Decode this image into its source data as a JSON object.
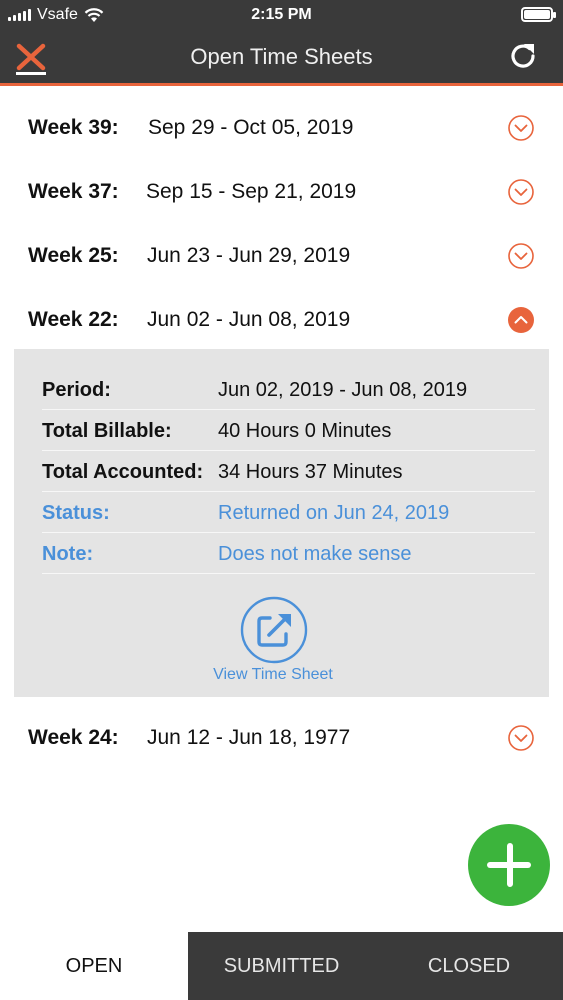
{
  "status_bar": {
    "carrier": "Vsafe",
    "time": "2:15 PM"
  },
  "header": {
    "title": "Open Time Sheets",
    "logo_icon": "x-logo-icon",
    "refresh_icon": "refresh-icon"
  },
  "colors": {
    "accent": "#e8643c",
    "header_bg": "#3a3a3a",
    "link_blue": "#4a90d9",
    "fab_green": "#3cb43c",
    "detail_bg": "#e4e4e4"
  },
  "weeks": [
    {
      "label": "Week 39:",
      "range": "Sep 29 - Oct 05, 2019",
      "expanded": false
    },
    {
      "label": "Week 37:",
      "range": "Sep 15 - Sep 21, 2019",
      "expanded": false
    },
    {
      "label": "Week 25:",
      "range": "Jun 23 - Jun 29, 2019",
      "expanded": false
    },
    {
      "label": "Week 22:",
      "range": "Jun 02 - Jun 08, 2019",
      "expanded": true
    },
    {
      "label": "Week 24:",
      "range": "Jun 12 - Jun 18, 1977",
      "expanded": false
    }
  ],
  "detail": {
    "rows": [
      {
        "label": "Period:",
        "value": "Jun 02, 2019 - Jun 08, 2019"
      },
      {
        "label": "Total Billable:",
        "value": "40 Hours 0 Minutes"
      },
      {
        "label": "Total Accounted:",
        "value": "34 Hours 37 Minutes"
      },
      {
        "label": "Status:",
        "value": "Returned on Jun 24, 2019"
      },
      {
        "label": "Note:",
        "value": "Does not make sense"
      }
    ],
    "view_label": "View Time Sheet"
  },
  "tabs": [
    {
      "label": "OPEN",
      "active": true
    },
    {
      "label": "SUBMITTED",
      "active": false
    },
    {
      "label": "CLOSED",
      "active": false
    }
  ]
}
